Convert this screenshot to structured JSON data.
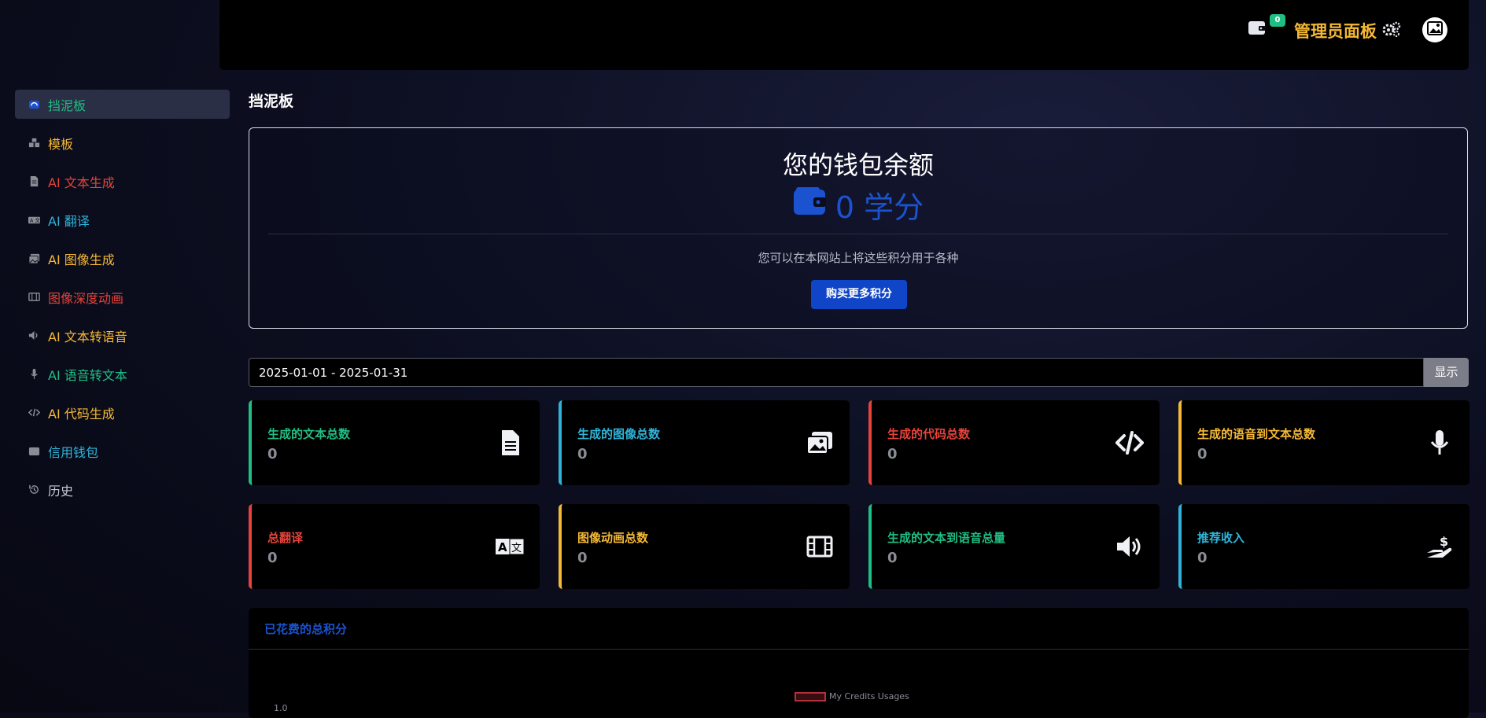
{
  "topbar": {
    "wallet_badge": "0",
    "admin_label": "管理员面板"
  },
  "sidebar": {
    "items": [
      {
        "label": "挡泥板",
        "color": "#1fbf84",
        "icon": "dashboard-icon"
      },
      {
        "label": "模板",
        "color": "#f5b935",
        "icon": "templates-icon"
      },
      {
        "label": "AI 文本生成",
        "color": "#e6443a",
        "icon": "document-icon"
      },
      {
        "label": "AI 翻译",
        "color": "#2fb4d9",
        "icon": "translate-icon"
      },
      {
        "label": "AI 图像生成",
        "color": "#f5b935",
        "icon": "images-icon"
      },
      {
        "label": "图像深度动画",
        "color": "#e6443a",
        "icon": "film-icon"
      },
      {
        "label": "AI 文本转语音",
        "color": "#f5b935",
        "icon": "speaker-icon"
      },
      {
        "label": "AI 语音转文本",
        "color": "#1fbf84",
        "icon": "microphone-icon"
      },
      {
        "label": "AI 代码生成",
        "color": "#f5b935",
        "icon": "code-icon"
      },
      {
        "label": "信用钱包",
        "color": "#2fb4d9",
        "icon": "wallet-icon"
      },
      {
        "label": "历史",
        "color": "#c8cad3",
        "icon": "history-icon"
      }
    ]
  },
  "page": {
    "title": "挡泥板"
  },
  "wallet": {
    "title": "您的钱包余额",
    "balance": "0 学分",
    "description": "您可以在本网站上将这些积分用于各种",
    "buy_label": "购买更多积分"
  },
  "filter": {
    "date_range": "2025-01-01 - 2025-01-31",
    "show_label": "显示"
  },
  "stats": [
    {
      "label": "生成的文本总数",
      "value": "0",
      "color": "#1fbf84",
      "icon": "document-icon"
    },
    {
      "label": "生成的图像总数",
      "value": "0",
      "color": "#2fb4d9",
      "icon": "images-icon"
    },
    {
      "label": "生成的代码总数",
      "value": "0",
      "color": "#e6443a",
      "icon": "code-icon"
    },
    {
      "label": "生成的语音到文本总数",
      "value": "0",
      "color": "#f5b935",
      "icon": "microphone-icon"
    },
    {
      "label": "总翻译",
      "value": "0",
      "color": "#e6443a",
      "icon": "translate-icon"
    },
    {
      "label": "图像动画总数",
      "value": "0",
      "color": "#f5b935",
      "icon": "film-icon"
    },
    {
      "label": "生成的文本到语音总量",
      "value": "0",
      "color": "#1fbf84",
      "icon": "speaker-icon"
    },
    {
      "label": "推荐收入",
      "value": "0",
      "color": "#2fb4d9",
      "icon": "hand-dollar-icon"
    }
  ],
  "credits_panel": {
    "title": "已花费的总积分",
    "legend": "My Credits Usages",
    "ytick": "1.0"
  },
  "chart_data": {
    "type": "line",
    "series": [
      {
        "name": "My Credits Usages",
        "values": []
      }
    ],
    "ylim": [
      0,
      1.0
    ]
  }
}
